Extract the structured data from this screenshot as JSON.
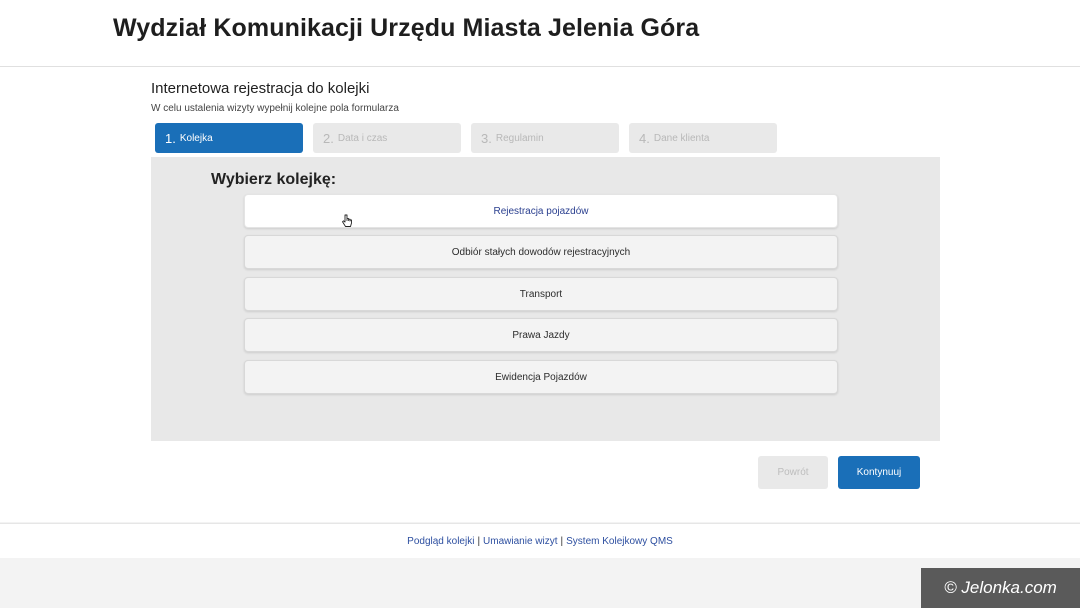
{
  "header": {
    "title": "Wydział Komunikacji Urzędu Miasta Jelenia Góra"
  },
  "page": {
    "title": "Internetowa rejestracja do kolejki",
    "subtitle": "W celu ustalenia wizyty wypełnij kolejne pola formularza"
  },
  "steps": [
    {
      "num": "1.",
      "label": "Kolejka",
      "active": true
    },
    {
      "num": "2.",
      "label": "Data i czas",
      "active": false
    },
    {
      "num": "3.",
      "label": "Regulamin",
      "active": false
    },
    {
      "num": "4.",
      "label": "Dane klienta",
      "active": false
    }
  ],
  "panel": {
    "heading": "Wybierz kolejkę:",
    "options": [
      {
        "label": "Rejestracja pojazdów",
        "selected": true
      },
      {
        "label": "Odbiór stałych dowodów rejestracyjnych",
        "selected": false
      },
      {
        "label": "Transport",
        "selected": false
      },
      {
        "label": "Prawa Jazdy",
        "selected": false
      },
      {
        "label": "Ewidencja Pojazdów",
        "selected": false
      }
    ]
  },
  "buttons": {
    "back": "Powrót",
    "next": "Kontynuuj"
  },
  "footer": {
    "links": [
      "Podgląd kolejki",
      "Umawianie wizyt",
      "System Kolejkowy QMS"
    ],
    "separator": "|"
  },
  "watermark": "© Jelonka.com",
  "colors": {
    "accent": "#1a6fb8",
    "panel": "#e8e8e8",
    "link": "#2d4fa0"
  },
  "icons": {
    "cursor": "hand-pointer-icon"
  }
}
